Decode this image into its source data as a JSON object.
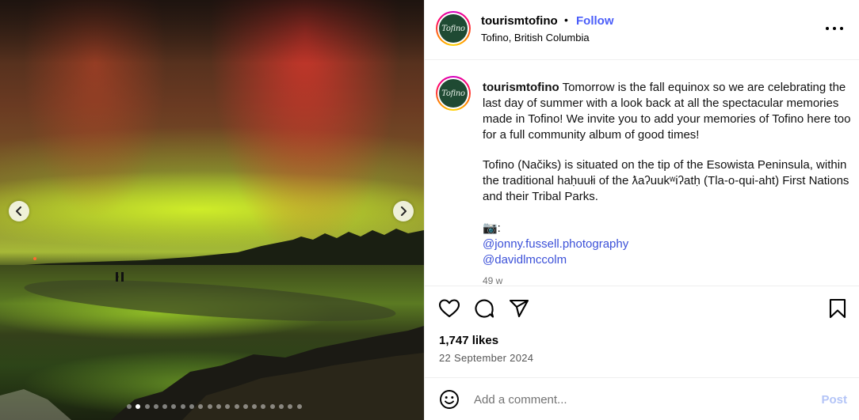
{
  "post": {
    "username": "tourismtofino",
    "follow_label": "Follow",
    "separator": "•",
    "location": "Tofino, British Columbia",
    "avatar_text": "Tofino"
  },
  "caption": {
    "username": "tourismtofino",
    "para1": "Tomorrow is the fall equinox so we are celebrating the last day of summer with a look back at all the spectacular memories made in Tofino! We invite you to add your memories of Tofino here too for a full community album of good times!",
    "para2": "Tofino (Načiks) is situated on the tip of the Esowista Peninsula, within the traditional haḥuułi of the ƛaʔuukʷiʔatḥ (Tla-o-qui-aht) First Nations and their Tribal Parks.",
    "camera": "📷:",
    "mention1": "@jonny.fussell.photography",
    "mention2": "@davidlmccolm",
    "time": "49 w"
  },
  "stats": {
    "likes": "1,747 likes",
    "date": "22 September 2024"
  },
  "comment": {
    "placeholder": "Add a comment...",
    "post_label": "Post"
  },
  "carousel": {
    "total_slides": 20,
    "active_index": 1
  },
  "icons": {
    "prev": "chevron-left-icon",
    "next": "chevron-right-icon",
    "more": "more-options-icon",
    "like": "heart-icon",
    "comment": "comment-icon",
    "share": "share-icon",
    "save": "bookmark-icon",
    "emoji": "emoji-icon"
  },
  "colors": {
    "follow": "#4a5df9",
    "link": "#3b50d8",
    "post_disabled": "#b3c4f7"
  }
}
